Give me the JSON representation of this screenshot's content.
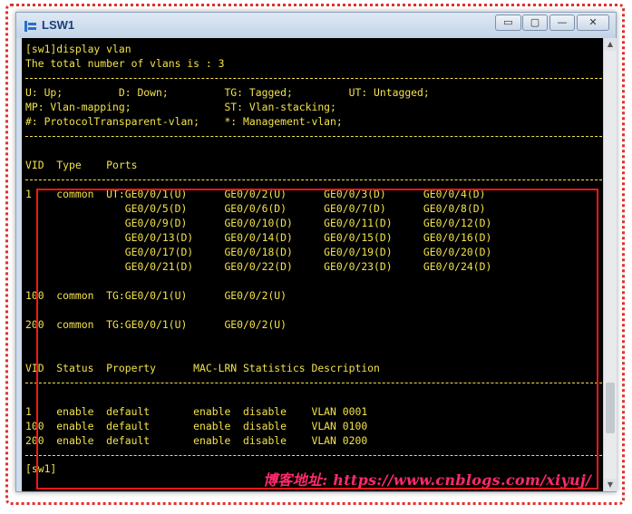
{
  "window": {
    "title": "LSW1",
    "controls": {
      "minimize": "▭",
      "maximize": "▢",
      "restore": "—",
      "close": "✕"
    }
  },
  "console": {
    "lines": [
      "[sw1]display vlan",
      "The total number of vlans is : 3",
      "U: Up;         D: Down;         TG: Tagged;         UT: Untagged;",
      "MP: Vlan-mapping;               ST: Vlan-stacking;",
      "#: ProtocolTransparent-vlan;    *: Management-vlan;",
      "VID  Type    Ports",
      "1    common  UT:GE0/0/1(U)      GE0/0/2(U)      GE0/0/3(D)      GE0/0/4(D)",
      "                GE0/0/5(D)      GE0/0/6(D)      GE0/0/7(D)      GE0/0/8(D)",
      "                GE0/0/9(D)      GE0/0/10(D)     GE0/0/11(D)     GE0/0/12(D)",
      "                GE0/0/13(D)     GE0/0/14(D)     GE0/0/15(D)     GE0/0/16(D)",
      "                GE0/0/17(D)     GE0/0/18(D)     GE0/0/19(D)     GE0/0/20(D)",
      "                GE0/0/21(D)     GE0/0/22(D)     GE0/0/23(D)     GE0/0/24(D)",
      "100  common  TG:GE0/0/1(U)      GE0/0/2(U)",
      "200  common  TG:GE0/0/1(U)      GE0/0/2(U)",
      "VID  Status  Property      MAC-LRN Statistics Description",
      "1    enable  default       enable  disable    VLAN 0001",
      "100  enable  default       enable  disable    VLAN 0100",
      "200  enable  default       enable  disable    VLAN 0200",
      "[sw1]"
    ]
  },
  "watermark": "博客地址: https://www.cnblogs.com/xiyuj/",
  "colors": {
    "console_text": "#f2e24a",
    "console_bg": "#000000",
    "highlight": "#f01818"
  },
  "icons": {
    "app": "switch-icon"
  }
}
